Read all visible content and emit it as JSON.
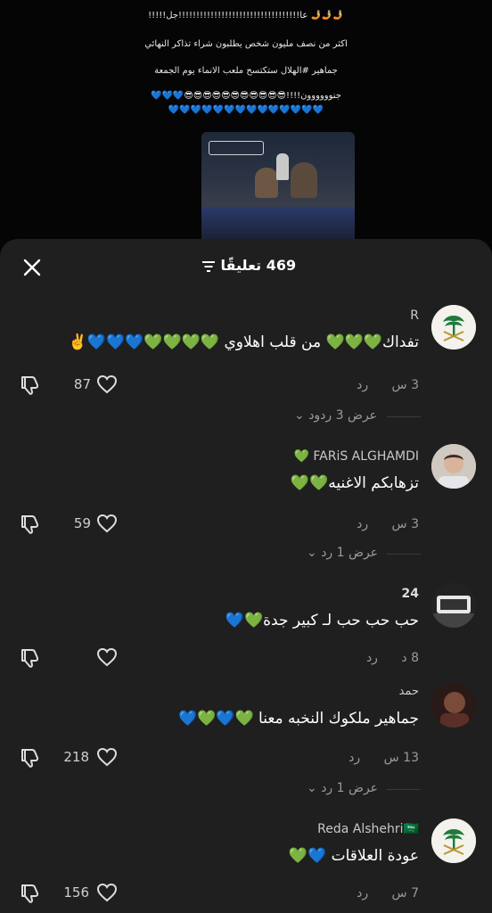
{
  "post": {
    "line1": "🤳🤳🤳 عا!!!!!!!!!!!!!!!!!!!!!!!!!!!!!!!!!!جل!!!!!",
    "line2": "اكثر من نصف مليون شخص يطلبون شراء تذاكر النهائي",
    "line3": "جماهير #الهلال ستكتسح ملعب الانماء يوم الجمعة",
    "line4": "جنوووووون!!!!😎😎😎😎😎😎😎😎😎😎😎💙💙💙",
    "line5": "💙💙💙💙💙💙💙💙💙💙💙💙💙💙"
  },
  "sheet": {
    "title": "469 تعليقًا",
    "close_icon": "close-icon",
    "sort_icon": "sort-icon"
  },
  "comments": [
    {
      "username": "R",
      "text": "تفداك💚💚💚 من قلب اهلاوي 💚💚💚💚💙💙💙✌️",
      "time": "3 س",
      "reply_label": "رد",
      "likes": "87",
      "view_replies": "عرض 3 ردود",
      "avatar": "palm-swords-emblem"
    },
    {
      "username": "FARiS ALGHAMDI 💚",
      "text": "تزهابكم الاغنيه💚💚",
      "time": "3 س",
      "reply_label": "رد",
      "likes": "59",
      "view_replies": "عرض 1 رد",
      "avatar": "photo"
    },
    {
      "username": "24",
      "text": "حب حب حب لـ كبير جدة💚💙",
      "time": "8 د",
      "reply_label": "رد",
      "likes": "",
      "view_replies": "",
      "avatar": "photo"
    },
    {
      "username": "حمد",
      "text": "جماهير ملكوك النخبه معنا 💚💙💚💙",
      "time": "13 س",
      "reply_label": "رد",
      "likes": "218",
      "view_replies": "عرض 1 رد",
      "avatar": "photo"
    },
    {
      "username": "Reda Alshehri🇸🇦",
      "text": "عودة العلاقات 💙💚",
      "time": "7 س",
      "reply_label": "رد",
      "likes": "156",
      "view_replies": "",
      "avatar": "palm-swords-emblem"
    }
  ],
  "colors": {
    "sheet_bg": "#1f1f1f",
    "background": "#000000",
    "muted_text": "#9a9a9a"
  }
}
